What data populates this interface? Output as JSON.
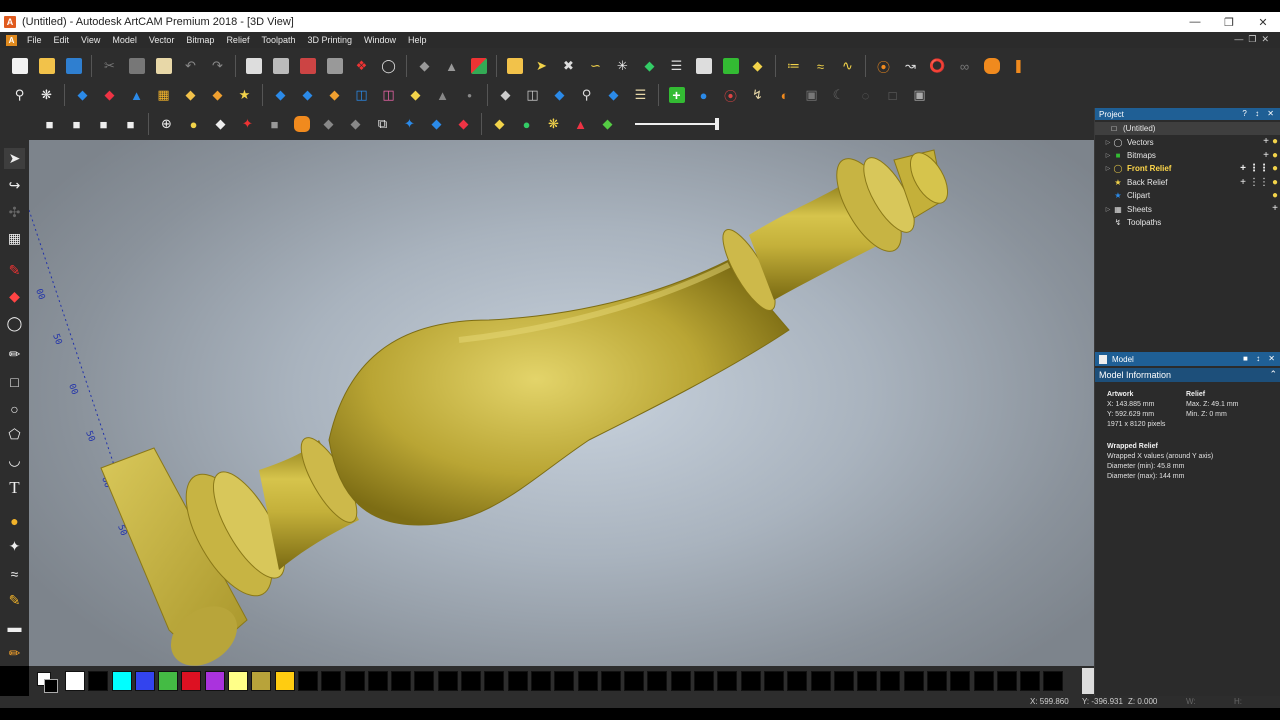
{
  "window": {
    "title": "(Untitled) - Autodesk ArtCAM Premium 2018 - [3D View]",
    "app_icon": "A"
  },
  "menu": [
    "File",
    "Edit",
    "View",
    "Model",
    "Vector",
    "Bitmap",
    "Relief",
    "Toolpath",
    "3D Printing",
    "Window",
    "Help"
  ],
  "colors": {
    "panel_bg": "#2b2b2b",
    "accent": "#1f5f95",
    "model_gold": "#c9b43a",
    "selected_text": "#ffd84a"
  },
  "toolbar_rows": [
    [
      "new-file",
      "open-folder",
      "save",
      "cut",
      "copy",
      "paste",
      "undo",
      "redo",
      "notes",
      "frame",
      "mirror",
      "grid",
      "magnet",
      "circle-tool",
      "eraser",
      "stamp",
      "merge",
      "open-folder-alt",
      "arrow-right",
      "scissors",
      "curve",
      "star-burst",
      "diamond-green",
      "layers",
      "frame-alt",
      "copy-green",
      "yellow-diamond",
      "nodes",
      "wave",
      "graph",
      "orange-ring",
      "bend",
      "torus",
      "spiral",
      "cylinder",
      "orange-bracket"
    ],
    [
      "zoom-fit",
      "relief-view",
      "blue-diamond",
      "red-diamond",
      "blue-cube",
      "waffle",
      "yellow-top",
      "orange-top",
      "star-card",
      "blue-plane",
      "blue-plane2",
      "orange-plane",
      "blue-stack",
      "pink-stack",
      "red-diamond-yellow",
      "grey-stack",
      "bulb-grey",
      "slice",
      "layer-stack",
      "blue-wedge",
      "jar",
      "flat-blue",
      "gold-stack",
      "green-plus",
      "dome",
      "spiral-red",
      "anchor",
      "shield",
      "grid-sel",
      "moon",
      "oval",
      "frame-grey",
      "select-box"
    ],
    [
      "cube-front",
      "cube-top",
      "cube-iso",
      "cube-right",
      "zoom-in",
      "bulb",
      "white-plate",
      "axes",
      "grey-box",
      "orange-cylinder",
      "grey-plate",
      "grey-plate2",
      "outline",
      "blue-star",
      "blue-red-layer",
      "red-layer",
      "yellow-plate",
      "green-ball",
      "star-zoom",
      "prism",
      "colour-layers",
      "slider"
    ]
  ],
  "project": {
    "title": "Project",
    "items": [
      {
        "label": "(Untitled)",
        "icon": "document-icon",
        "expandable": false,
        "selected": true,
        "indent": 0
      },
      {
        "label": "Vectors",
        "icon": "vector-icon",
        "expandable": true,
        "indent": 1,
        "actions": [
          "+",
          "bulb"
        ]
      },
      {
        "label": "Bitmaps",
        "icon": "bitmap-icon",
        "expandable": true,
        "indent": 1,
        "actions": [
          "+",
          "bulb"
        ]
      },
      {
        "label": "Front Relief",
        "icon": "relief-icon",
        "expandable": true,
        "indent": 1,
        "bold": true,
        "actions": [
          "+",
          "grid",
          "bulb"
        ]
      },
      {
        "label": "Back Relief",
        "icon": "star-icon",
        "expandable": false,
        "indent": 1,
        "actions": [
          "+",
          "grid",
          "bulb"
        ]
      },
      {
        "label": "Clipart",
        "icon": "clipart-icon",
        "expandable": false,
        "indent": 1,
        "actions": [
          "bulb"
        ]
      },
      {
        "label": "Sheets",
        "icon": "sheets-icon",
        "expandable": true,
        "indent": 1,
        "actions": [
          "+"
        ]
      },
      {
        "label": "Toolpaths",
        "icon": "toolpath-icon",
        "expandable": false,
        "indent": 1
      }
    ]
  },
  "model": {
    "title": "Model",
    "info_title": "Model Information",
    "artwork": {
      "heading": "Artwork",
      "x": "X: 143.885 mm",
      "y": "Y: 592.629 mm",
      "pixels": "1971 x 8120 pixels"
    },
    "relief": {
      "heading": "Relief",
      "max_z": "Max. Z: 49.1 mm",
      "min_z": "Min. Z: 0 mm"
    },
    "wrapped": {
      "heading": "Wrapped Relief",
      "line1": "Wrapped X values (around Y axis)",
      "dmin": "Diameter (min): 45.8 mm",
      "dmax": "Diameter (max): 144 mm"
    }
  },
  "palette": [
    "#ffffff",
    "#000000",
    "#00ffff",
    "#3344ee",
    "#44bb44",
    "#dd1122",
    "#aa33dd",
    "#ffff88",
    "#b8a33a",
    "#ffcc11",
    "#000000",
    "#000000",
    "#000000",
    "#000000",
    "#000000",
    "#000000",
    "#000000",
    "#000000",
    "#000000",
    "#000000",
    "#000000",
    "#000000",
    "#000000",
    "#000000",
    "#000000",
    "#000000",
    "#000000",
    "#000000",
    "#000000",
    "#000000",
    "#000000",
    "#000000",
    "#000000",
    "#000000",
    "#000000",
    "#000000",
    "#000000",
    "#000000",
    "#000000",
    "#000000",
    "#000000",
    "#000000",
    "#000000"
  ],
  "status": {
    "x": "X: 599.860",
    "y": "Y: -396.931",
    "z": "Z: 0.000",
    "w": "W:",
    "h": "H:"
  },
  "ruler_labels": [
    "00",
    "50",
    "00",
    "50",
    "00",
    "50"
  ],
  "left_tools": [
    "select-arrow-icon",
    "node-edit-icon",
    "transform-icon",
    "grid-tool-icon",
    "pen-icon",
    "eraser-icon",
    "shape-icon",
    "polyline-icon",
    "rectangle-icon",
    "circle-icon",
    "polygon-icon",
    "arc-icon",
    "text-icon",
    "drop-icon",
    "sculpt-icon",
    "brush-icon",
    "pencil-icon",
    "smooth-icon",
    "fill-icon",
    "knife-icon"
  ]
}
